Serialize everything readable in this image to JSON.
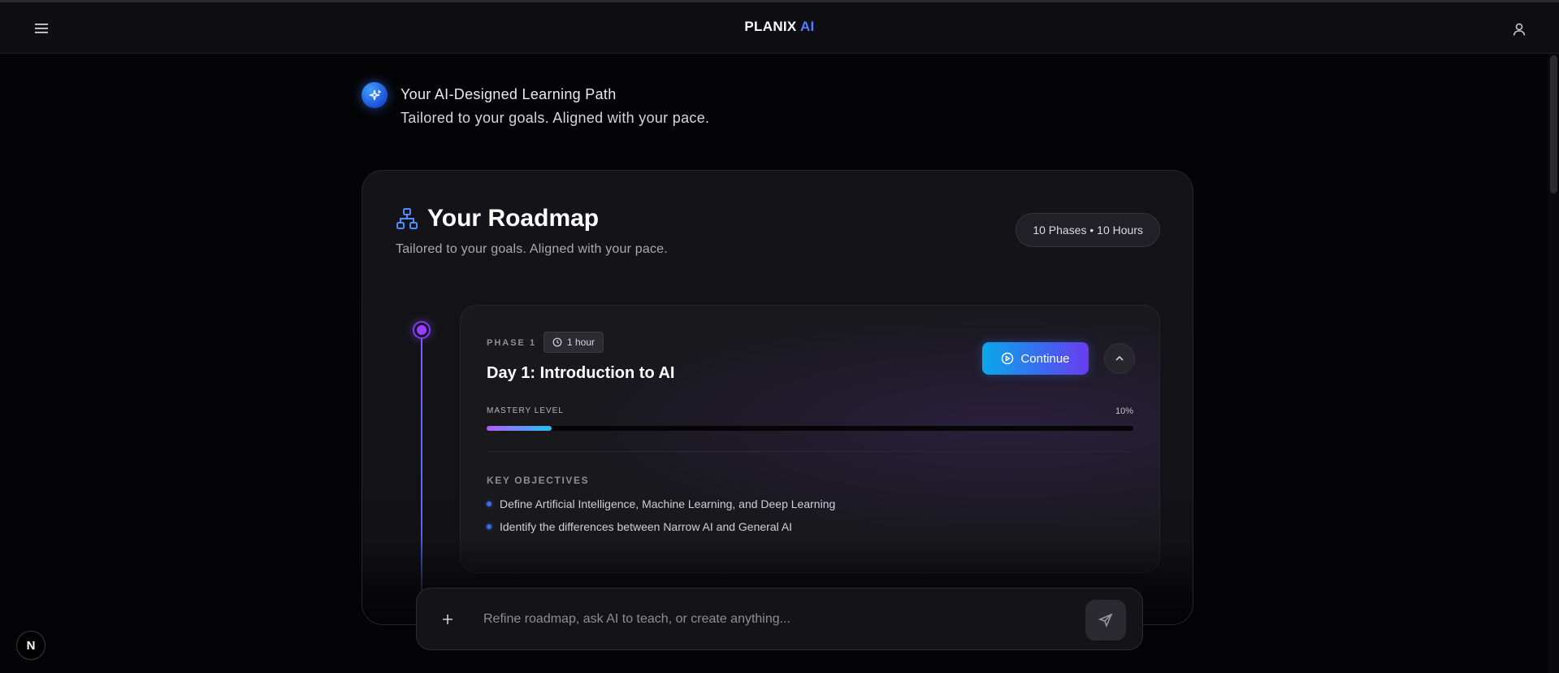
{
  "header": {
    "brand_main": "PLANIX ",
    "brand_accent": "AI",
    "menu_icon": "hamburger-menu-icon",
    "user_icon": "user-icon"
  },
  "intro": {
    "title": "Your AI-Designed Learning Path",
    "subtitle": "Tailored to your goals. Aligned with your pace.",
    "icon": "sparkle-icon"
  },
  "roadmap": {
    "icon": "sitemap-icon",
    "title": "Your Roadmap",
    "subtitle": "Tailored to your goals. Aligned with your pace.",
    "summary_badge": "10 Phases • 10 Hours",
    "phase": {
      "label": "PHASE 1",
      "duration": "1 hour",
      "title": "Day 1: Introduction to AI",
      "continue_label": "Continue",
      "mastery_label": "MASTERY LEVEL",
      "mastery_value": "10%",
      "mastery_fraction": 0.1,
      "objectives_title": "KEY OBJECTIVES",
      "objectives": [
        "Define Artificial Intelligence, Machine Learning, and Deep Learning",
        "Identify the differences between Narrow AI and General AI"
      ]
    }
  },
  "chat": {
    "placeholder": "Refine roadmap, ask AI to teach, or create anything...",
    "value": ""
  },
  "corner_badge": "N",
  "colors": {
    "accent_blue": "#4f7dff",
    "timeline_dot": "#9b3dff",
    "progress_start": "#b45cff",
    "progress_end": "#22c4ee"
  }
}
